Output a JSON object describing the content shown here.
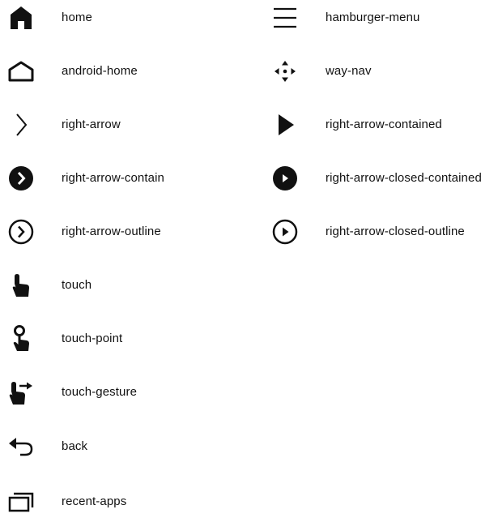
{
  "icons": {
    "left": [
      {
        "label": "home",
        "icon": "home-icon"
      },
      {
        "label": "android-home",
        "icon": "android-home-icon"
      },
      {
        "label": "right-arrow",
        "icon": "right-arrow-icon"
      },
      {
        "label": "right-arrow-contain",
        "icon": "right-arrow-contain-icon"
      },
      {
        "label": "right-arrow-outline",
        "icon": "right-arrow-outline-icon"
      },
      {
        "label": "touch",
        "icon": "touch-icon"
      },
      {
        "label": "touch-point",
        "icon": "touch-point-icon"
      },
      {
        "label": "touch-gesture",
        "icon": "touch-gesture-icon"
      },
      {
        "label": "back",
        "icon": "back-icon"
      },
      {
        "label": "recent-apps",
        "icon": "recent-apps-icon"
      }
    ],
    "right": [
      {
        "label": "hamburger-menu",
        "icon": "hamburger-menu-icon"
      },
      {
        "label": "way-nav",
        "icon": "way-nav-icon"
      },
      {
        "label": "right-arrow-contained",
        "icon": "right-arrow-contained-icon"
      },
      {
        "label": "right-arrow-closed-contained",
        "icon": "right-arrow-closed-contained-icon"
      },
      {
        "label": "right-arrow-closed-outline",
        "icon": "right-arrow-closed-outline-icon"
      }
    ]
  },
  "colors": {
    "icon": "#111111",
    "text": "#111111",
    "background": "#ffffff"
  }
}
